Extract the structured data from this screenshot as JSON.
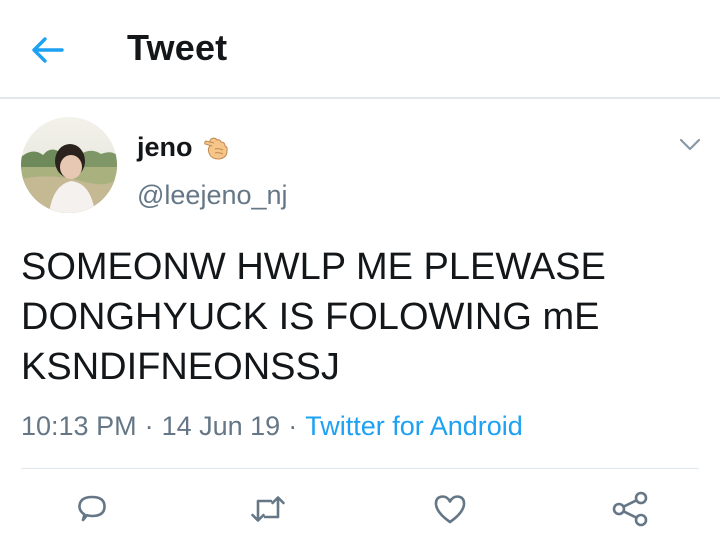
{
  "header": {
    "title": "Tweet",
    "back_icon": "arrow-left-icon"
  },
  "author": {
    "display_name": "jeno",
    "handle": "@leejeno_nj",
    "name_emoji": "backhand-index-pointing-left-emoji"
  },
  "tweet": {
    "text": "SOMEONW HWLP ME PLEWASE\nDONGHYUCK IS FOLOWING mE\nKSNDIFNEONSSJ",
    "time": "10:13 PM",
    "date": "14 Jun 19",
    "separator": "·",
    "source": "Twitter for Android"
  },
  "actions": {
    "icons": [
      "reply-icon",
      "retweet-icon",
      "like-icon",
      "share-icon"
    ]
  },
  "colors": {
    "accent": "#1da1f2",
    "text": "#14171a",
    "muted": "#657786",
    "divider": "#e1e8ed",
    "icon": "#657786"
  }
}
